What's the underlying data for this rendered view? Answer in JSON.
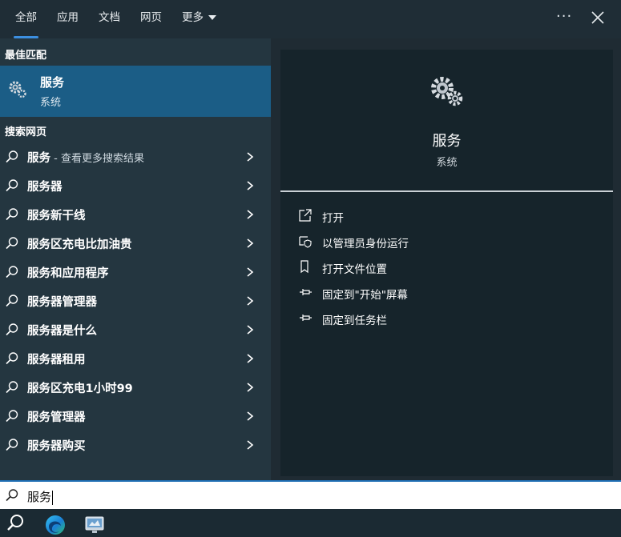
{
  "tabs": [
    "全部",
    "应用",
    "文档",
    "网页",
    "更多"
  ],
  "best_match": {
    "header": "最佳匹配",
    "title": "服务",
    "subtitle": "系统",
    "icon": "gears-icon"
  },
  "web": {
    "header": "搜索网页",
    "items": [
      {
        "label": "服务",
        "suffix": " - 查看更多搜索结果"
      },
      {
        "label": "服务器",
        "suffix": ""
      },
      {
        "label": "服务新干线",
        "suffix": ""
      },
      {
        "label": "服务区充电比加油贵",
        "suffix": ""
      },
      {
        "label": "服务和应用程序",
        "suffix": ""
      },
      {
        "label": "服务器管理器",
        "suffix": ""
      },
      {
        "label": "服务器是什么",
        "suffix": ""
      },
      {
        "label": "服务器租用",
        "suffix": ""
      },
      {
        "label": "服务区充电1小时99",
        "suffix": ""
      },
      {
        "label": "服务管理器",
        "suffix": ""
      },
      {
        "label": "服务器购买",
        "suffix": ""
      }
    ]
  },
  "detail": {
    "title": "服务",
    "subtitle": "系统",
    "actions": [
      {
        "label": "打开",
        "icon": "open-icon"
      },
      {
        "label": "以管理员身份运行",
        "icon": "shield-icon"
      },
      {
        "label": "打开文件位置",
        "icon": "file-location-icon"
      },
      {
        "label": "固定到\"开始\"屏幕",
        "icon": "pin-icon"
      },
      {
        "label": "固定到任务栏",
        "icon": "pin-icon"
      }
    ]
  },
  "search": {
    "value": "服务"
  },
  "colors": {
    "accent": "#3c8fe0",
    "selected": "#1b5d86"
  }
}
